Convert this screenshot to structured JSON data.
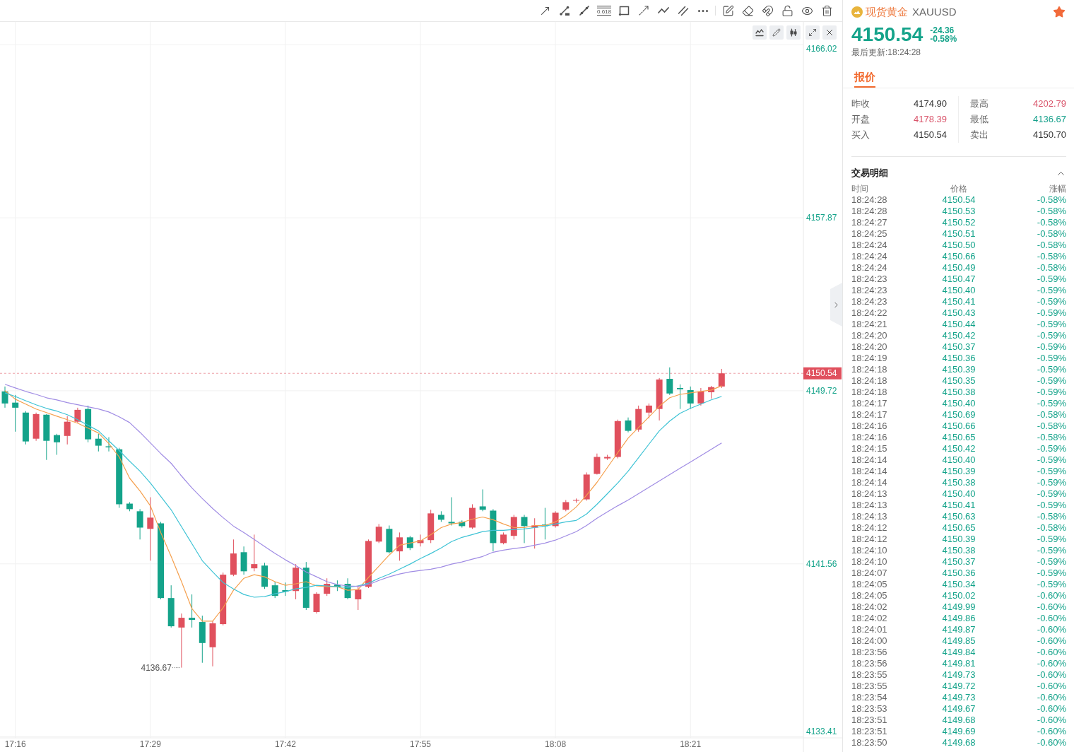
{
  "drawing_toolbar": {
    "fib_level": "0.618"
  },
  "chart": {
    "chart_data": [
      {
        "type": "candlestick",
        "categories": [
          null,
          "17:16",
          null,
          null,
          null,
          null,
          null,
          null,
          null,
          null,
          null,
          null,
          null,
          null,
          "17:29",
          null,
          null,
          null,
          null,
          null,
          null,
          null,
          null,
          null,
          null,
          null,
          null,
          "17:42",
          null,
          null,
          null,
          null,
          null,
          null,
          null,
          null,
          null,
          null,
          null,
          null,
          "17:55",
          null,
          null,
          null,
          null,
          null,
          null,
          null,
          null,
          null,
          null,
          null,
          null,
          "18:08",
          null,
          null,
          null,
          null,
          null,
          null,
          null,
          null,
          null,
          null,
          null,
          null,
          "18:21",
          null,
          null,
          null
        ],
        "series": [
          {
            "type": "candlestick",
            "ohlc": [
              [
                4149.69,
                4149.92,
                4148.92,
                4149.12
              ],
              [
                4149.16,
                4149.52,
                4147.79,
                4148.92
              ],
              [
                4148.69,
                4148.76,
                4147.19,
                4147.33
              ],
              [
                4147.46,
                4148.69,
                4147.36,
                4148.62
              ],
              [
                4148.59,
                4148.62,
                4146.46,
                4147.36
              ],
              [
                4147.63,
                4147.69,
                4146.7,
                4147.29
              ],
              [
                4147.59,
                4148.52,
                4147.19,
                4148.26
              ],
              [
                4148.26,
                4148.92,
                4148.19,
                4148.82
              ],
              [
                4148.86,
                4149.02,
                4147.29,
                4147.43
              ],
              [
                4147.46,
                4147.69,
                4146.86,
                4147.13
              ],
              [
                4147.1,
                4147.53,
                4146.86,
                4147.05
              ],
              [
                4146.96,
                4147.03,
                4144.2,
                4144.37
              ],
              [
                4144.4,
                4144.47,
                4144.04,
                4144.14
              ],
              [
                4144.04,
                4144.14,
                4142.71,
                4143.27
              ],
              [
                4143.21,
                4144.7,
                4141.71,
                4143.74
              ],
              [
                4143.47,
                4143.54,
                4139.89,
                4139.95
              ],
              [
                4139.95,
                4140.55,
                4138.56,
                4138.62
              ],
              [
                4138.56,
                4139.22,
                4136.67,
                4139.02
              ],
              [
                4139.02,
                4140.12,
                4138.56,
                4138.92
              ],
              [
                4138.82,
                4139.12,
                4136.9,
                4137.83
              ],
              [
                4137.63,
                4138.89,
                4136.73,
                4138.76
              ],
              [
                4138.72,
                4141.15,
                4138.66,
                4141.05
              ],
              [
                4141.05,
                4142.71,
                4140.98,
                4142.05
              ],
              [
                4142.11,
                4142.38,
                4141.05,
                4141.21
              ],
              [
                4141.35,
                4142.94,
                4141.21,
                4141.55
              ],
              [
                4141.48,
                4141.61,
                4140.38,
                4140.48
              ],
              [
                4140.55,
                4140.72,
                4139.95,
                4140.05
              ],
              [
                4140.32,
                4140.68,
                4140.05,
                4140.25
              ],
              [
                4140.28,
                4141.55,
                4139.89,
                4141.38
              ],
              [
                4141.38,
                4141.65,
                4139.39,
                4139.49
              ],
              [
                4139.29,
                4140.22,
                4139.22,
                4140.15
              ],
              [
                4140.15,
                4140.88,
                4140.05,
                4140.62
              ],
              [
                4140.58,
                4140.78,
                4140.28,
                4140.48
              ],
              [
                4140.62,
                4140.88,
                4139.89,
                4139.95
              ],
              [
                4139.89,
                4140.55,
                4139.39,
                4140.35
              ],
              [
                4140.48,
                4142.71,
                4140.42,
                4142.64
              ],
              [
                4142.61,
                4143.44,
                4142.54,
                4143.31
              ],
              [
                4143.21,
                4143.37,
                4142.05,
                4142.11
              ],
              [
                4142.15,
                4143.04,
                4141.71,
                4142.81
              ],
              [
                4142.81,
                4142.88,
                4142.21,
                4142.31
              ],
              [
                4142.54,
                4142.94,
                4142.38,
                4142.68
              ],
              [
                4142.68,
                4144.11,
                4142.54,
                4143.94
              ],
              [
                4143.87,
                4144.04,
                4143.54,
                4143.64
              ],
              [
                4143.54,
                4144.7,
                4143.37,
                4143.47
              ],
              [
                4143.54,
                4143.61,
                4143.27,
                4143.34
              ],
              [
                4143.27,
                4144.37,
                4143.21,
                4144.2
              ],
              [
                4144.27,
                4145.07,
                4144.04,
                4144.11
              ],
              [
                4144.07,
                4144.14,
                4142.15,
                4142.54
              ],
              [
                4142.54,
                4143.04,
                4142.48,
                4142.94
              ],
              [
                4142.88,
                4143.87,
                4142.71,
                4143.77
              ],
              [
                4143.77,
                4143.87,
                4142.54,
                4143.34
              ],
              [
                4143.27,
                4143.71,
                4142.28,
                4143.37
              ],
              [
                4143.41,
                4144.2,
                4142.71,
                4143.34
              ],
              [
                4143.34,
                4144.04,
                4143.27,
                4143.97
              ],
              [
                4144.11,
                4144.57,
                4144.04,
                4144.47
              ],
              [
                4144.54,
                4144.64,
                4144.44,
                4144.57
              ],
              [
                4144.6,
                4145.87,
                4144.54,
                4145.77
              ],
              [
                4145.8,
                4146.76,
                4145.77,
                4146.6
              ],
              [
                4146.53,
                4146.7,
                4146.46,
                4146.6
              ],
              [
                4146.6,
                4148.36,
                4146.53,
                4148.29
              ],
              [
                4148.32,
                4148.46,
                4147.76,
                4147.83
              ],
              [
                4147.89,
                4149.02,
                4147.79,
                4148.86
              ],
              [
                4148.69,
                4149.12,
                4148.42,
                4149.02
              ],
              [
                4148.86,
                4150.32,
                4148.32,
                4150.25
              ],
              [
                4150.28,
                4150.82,
                4149.52,
                4149.59
              ],
              [
                4149.85,
                4150.02,
                4148.86,
                4149.79
              ],
              [
                4149.75,
                4149.92,
                4148.86,
                4149.12
              ],
              [
                4149.12,
                4149.85,
                4149.02,
                4149.69
              ],
              [
                4149.65,
                4149.95,
                4149.35,
                4149.89
              ],
              [
                4149.92,
                4150.75,
                4149.85,
                4150.54
              ]
            ]
          },
          {
            "type": "line",
            "color": "#f5a04e",
            "values": [
              4149.72,
              4149.32,
              4149.09,
              4148.86,
              4148.69,
              4148.52,
              4148.36,
              4148.19,
              4147.96,
              4147.73,
              4147.23,
              4146.6,
              4145.6,
              4145.0,
              4144.3,
              4143.04,
              4141.91,
              4140.72,
              4139.45,
              4138.86,
              4138.86,
              4139.49,
              4140.32,
              4140.88,
              4141.05,
              4140.95,
              4140.72,
              4140.55,
              4140.62,
              4140.72,
              4140.52,
              4140.48,
              4140.48,
              4140.32,
              4140.35,
              4140.92,
              4141.45,
              4141.98,
              4142.44,
              4142.54,
              4142.64,
              4142.94,
              4143.27,
              4143.44,
              4143.51,
              4143.67,
              4143.77,
              4143.64,
              4143.44,
              4143.27,
              4143.27,
              4143.37,
              4143.37,
              4143.54,
              4143.84,
              4144.24,
              4144.8,
              4145.4,
              4146.1,
              4146.8,
              4147.49,
              4147.99,
              4148.49,
              4148.99,
              4149.39,
              4149.55,
              4149.62,
              4149.69,
              4149.75,
              4149.95
            ]
          },
          {
            "type": "line",
            "color": "#3ec3d5",
            "values": [
              4149.62,
              4149.45,
              4149.25,
              4149.06,
              4148.89,
              4148.76,
              4148.59,
              4148.36,
              4148.09,
              4147.83,
              4147.36,
              4146.9,
              4146.4,
              4145.93,
              4145.37,
              4144.74,
              4144.11,
              4143.31,
              4142.51,
              4141.71,
              4141.18,
              4140.68,
              4140.38,
              4140.12,
              4139.99,
              4140.02,
              4140.15,
              4140.25,
              4140.38,
              4140.45,
              4140.55,
              4140.52,
              4140.48,
              4140.45,
              4140.52,
              4140.65,
              4140.88,
              4141.08,
              4141.31,
              4141.55,
              4141.81,
              4142.05,
              4142.31,
              4142.61,
              4142.81,
              4142.94,
              4143.08,
              4143.14,
              4143.14,
              4143.18,
              4143.21,
              4143.27,
              4143.34,
              4143.44,
              4143.54,
              4143.61,
              4143.91,
              4144.37,
              4144.87,
              4145.37,
              4145.93,
              4146.56,
              4147.2,
              4147.83,
              4148.29,
              4148.66,
              4148.89,
              4149.09,
              4149.29,
              4149.45
            ]
          },
          {
            "type": "line",
            "color": "#a08ce4",
            "values": [
              4150.02,
              4149.85,
              4149.69,
              4149.55,
              4149.39,
              4149.29,
              4149.16,
              4149.06,
              4148.96,
              4148.86,
              4148.72,
              4148.49,
              4148.22,
              4147.76,
              4147.26,
              4146.76,
              4146.3,
              4145.7,
              4145.14,
              4144.64,
              4144.17,
              4143.74,
              4143.34,
              4143.04,
              4142.71,
              4142.38,
              4142.05,
              4141.75,
              4141.48,
              4141.18,
              4140.95,
              4140.72,
              4140.58,
              4140.52,
              4140.5,
              4140.58,
              4140.78,
              4140.95,
              4141.08,
              4141.18,
              4141.25,
              4141.31,
              4141.41,
              4141.55,
              4141.65,
              4141.78,
              4141.91,
              4142.11,
              4142.21,
              4142.28,
              4142.34,
              4142.44,
              4142.54,
              4142.68,
              4142.88,
              4143.08,
              4143.37,
              4143.71,
              4144.01,
              4144.3,
              4144.57,
              4144.87,
              4145.17,
              4145.47,
              4145.77,
              4146.07,
              4146.36,
              4146.66,
              4146.96,
              4147.26
            ]
          }
        ],
        "ylim": [
          4133.36,
          4166.07
        ],
        "yticks": [
          4166.02,
          4157.87,
          4149.72,
          4141.56,
          4133.41
        ],
        "grid": true,
        "ref_lines": [
          {
            "axis": "y",
            "value": 4150.54,
            "label": "4150.54",
            "color": "#e0505d",
            "line_style": "dashed"
          }
        ],
        "annotations": [
          "4136.67"
        ]
      }
    ]
  },
  "quote": {
    "name": "现货黄金",
    "symbol": "XAUUSD",
    "favorite": true,
    "price": "4150.54",
    "falling": true,
    "change": "-24.36",
    "change_percent": "-0.58%",
    "updated": "最后更新:18:24:28",
    "tabs": [
      {
        "label": "报价",
        "selected": true
      }
    ],
    "stat_columns": [
      [
        {
          "label": "昨收",
          "value": "4174.90",
          "color": "#333333"
        },
        {
          "label": "开盘",
          "value": "4178.39",
          "color": "#d9546a"
        },
        {
          "label": "买入",
          "value": "4150.54",
          "color": "#333333"
        }
      ],
      [
        {
          "label": "最高",
          "value": "4202.79",
          "color": "#d9546a"
        },
        {
          "label": "最低",
          "value": "4136.67",
          "color": "#16a08b"
        },
        {
          "label": "卖出",
          "value": "4150.70",
          "color": "#333333"
        }
      ]
    ]
  },
  "trades": {
    "title": "交易明细",
    "expanded": true,
    "columns": [
      "时间",
      "价格",
      "涨幅"
    ],
    "rows": [
      {
        "time": "18:24:28",
        "price": "4150.54",
        "change": "-0.58%"
      },
      {
        "time": "18:24:28",
        "price": "4150.53",
        "change": "-0.58%"
      },
      {
        "time": "18:24:27",
        "price": "4150.52",
        "change": "-0.58%"
      },
      {
        "time": "18:24:25",
        "price": "4150.51",
        "change": "-0.58%"
      },
      {
        "time": "18:24:24",
        "price": "4150.50",
        "change": "-0.58%"
      },
      {
        "time": "18:24:24",
        "price": "4150.66",
        "change": "-0.58%"
      },
      {
        "time": "18:24:24",
        "price": "4150.49",
        "change": "-0.58%"
      },
      {
        "time": "18:24:23",
        "price": "4150.47",
        "change": "-0.59%"
      },
      {
        "time": "18:24:23",
        "price": "4150.40",
        "change": "-0.59%"
      },
      {
        "time": "18:24:23",
        "price": "4150.41",
        "change": "-0.59%"
      },
      {
        "time": "18:24:22",
        "price": "4150.43",
        "change": "-0.59%"
      },
      {
        "time": "18:24:21",
        "price": "4150.44",
        "change": "-0.59%"
      },
      {
        "time": "18:24:20",
        "price": "4150.42",
        "change": "-0.59%"
      },
      {
        "time": "18:24:20",
        "price": "4150.37",
        "change": "-0.59%"
      },
      {
        "time": "18:24:19",
        "price": "4150.36",
        "change": "-0.59%"
      },
      {
        "time": "18:24:18",
        "price": "4150.39",
        "change": "-0.59%"
      },
      {
        "time": "18:24:18",
        "price": "4150.35",
        "change": "-0.59%"
      },
      {
        "time": "18:24:18",
        "price": "4150.38",
        "change": "-0.59%"
      },
      {
        "time": "18:24:17",
        "price": "4150.40",
        "change": "-0.59%"
      },
      {
        "time": "18:24:17",
        "price": "4150.69",
        "change": "-0.58%"
      },
      {
        "time": "18:24:16",
        "price": "4150.66",
        "change": "-0.58%"
      },
      {
        "time": "18:24:16",
        "price": "4150.65",
        "change": "-0.58%"
      },
      {
        "time": "18:24:15",
        "price": "4150.42",
        "change": "-0.59%"
      },
      {
        "time": "18:24:14",
        "price": "4150.40",
        "change": "-0.59%"
      },
      {
        "time": "18:24:14",
        "price": "4150.39",
        "change": "-0.59%"
      },
      {
        "time": "18:24:14",
        "price": "4150.38",
        "change": "-0.59%"
      },
      {
        "time": "18:24:13",
        "price": "4150.40",
        "change": "-0.59%"
      },
      {
        "time": "18:24:13",
        "price": "4150.41",
        "change": "-0.59%"
      },
      {
        "time": "18:24:13",
        "price": "4150.63",
        "change": "-0.58%"
      },
      {
        "time": "18:24:12",
        "price": "4150.65",
        "change": "-0.58%"
      },
      {
        "time": "18:24:12",
        "price": "4150.39",
        "change": "-0.59%"
      },
      {
        "time": "18:24:10",
        "price": "4150.38",
        "change": "-0.59%"
      },
      {
        "time": "18:24:10",
        "price": "4150.37",
        "change": "-0.59%"
      },
      {
        "time": "18:24:07",
        "price": "4150.36",
        "change": "-0.59%"
      },
      {
        "time": "18:24:05",
        "price": "4150.34",
        "change": "-0.59%"
      },
      {
        "time": "18:24:05",
        "price": "4150.02",
        "change": "-0.60%"
      },
      {
        "time": "18:24:02",
        "price": "4149.99",
        "change": "-0.60%"
      },
      {
        "time": "18:24:02",
        "price": "4149.86",
        "change": "-0.60%"
      },
      {
        "time": "18:24:01",
        "price": "4149.87",
        "change": "-0.60%"
      },
      {
        "time": "18:24:00",
        "price": "4149.85",
        "change": "-0.60%"
      },
      {
        "time": "18:23:56",
        "price": "4149.84",
        "change": "-0.60%"
      },
      {
        "time": "18:23:56",
        "price": "4149.81",
        "change": "-0.60%"
      },
      {
        "time": "18:23:55",
        "price": "4149.73",
        "change": "-0.60%"
      },
      {
        "time": "18:23:55",
        "price": "4149.72",
        "change": "-0.60%"
      },
      {
        "time": "18:23:54",
        "price": "4149.73",
        "change": "-0.60%"
      },
      {
        "time": "18:23:53",
        "price": "4149.67",
        "change": "-0.60%"
      },
      {
        "time": "18:23:51",
        "price": "4149.68",
        "change": "-0.60%"
      },
      {
        "time": "18:23:51",
        "price": "4149.69",
        "change": "-0.60%"
      },
      {
        "time": "18:23:50",
        "price": "4149.68",
        "change": "-0.60%"
      }
    ]
  }
}
